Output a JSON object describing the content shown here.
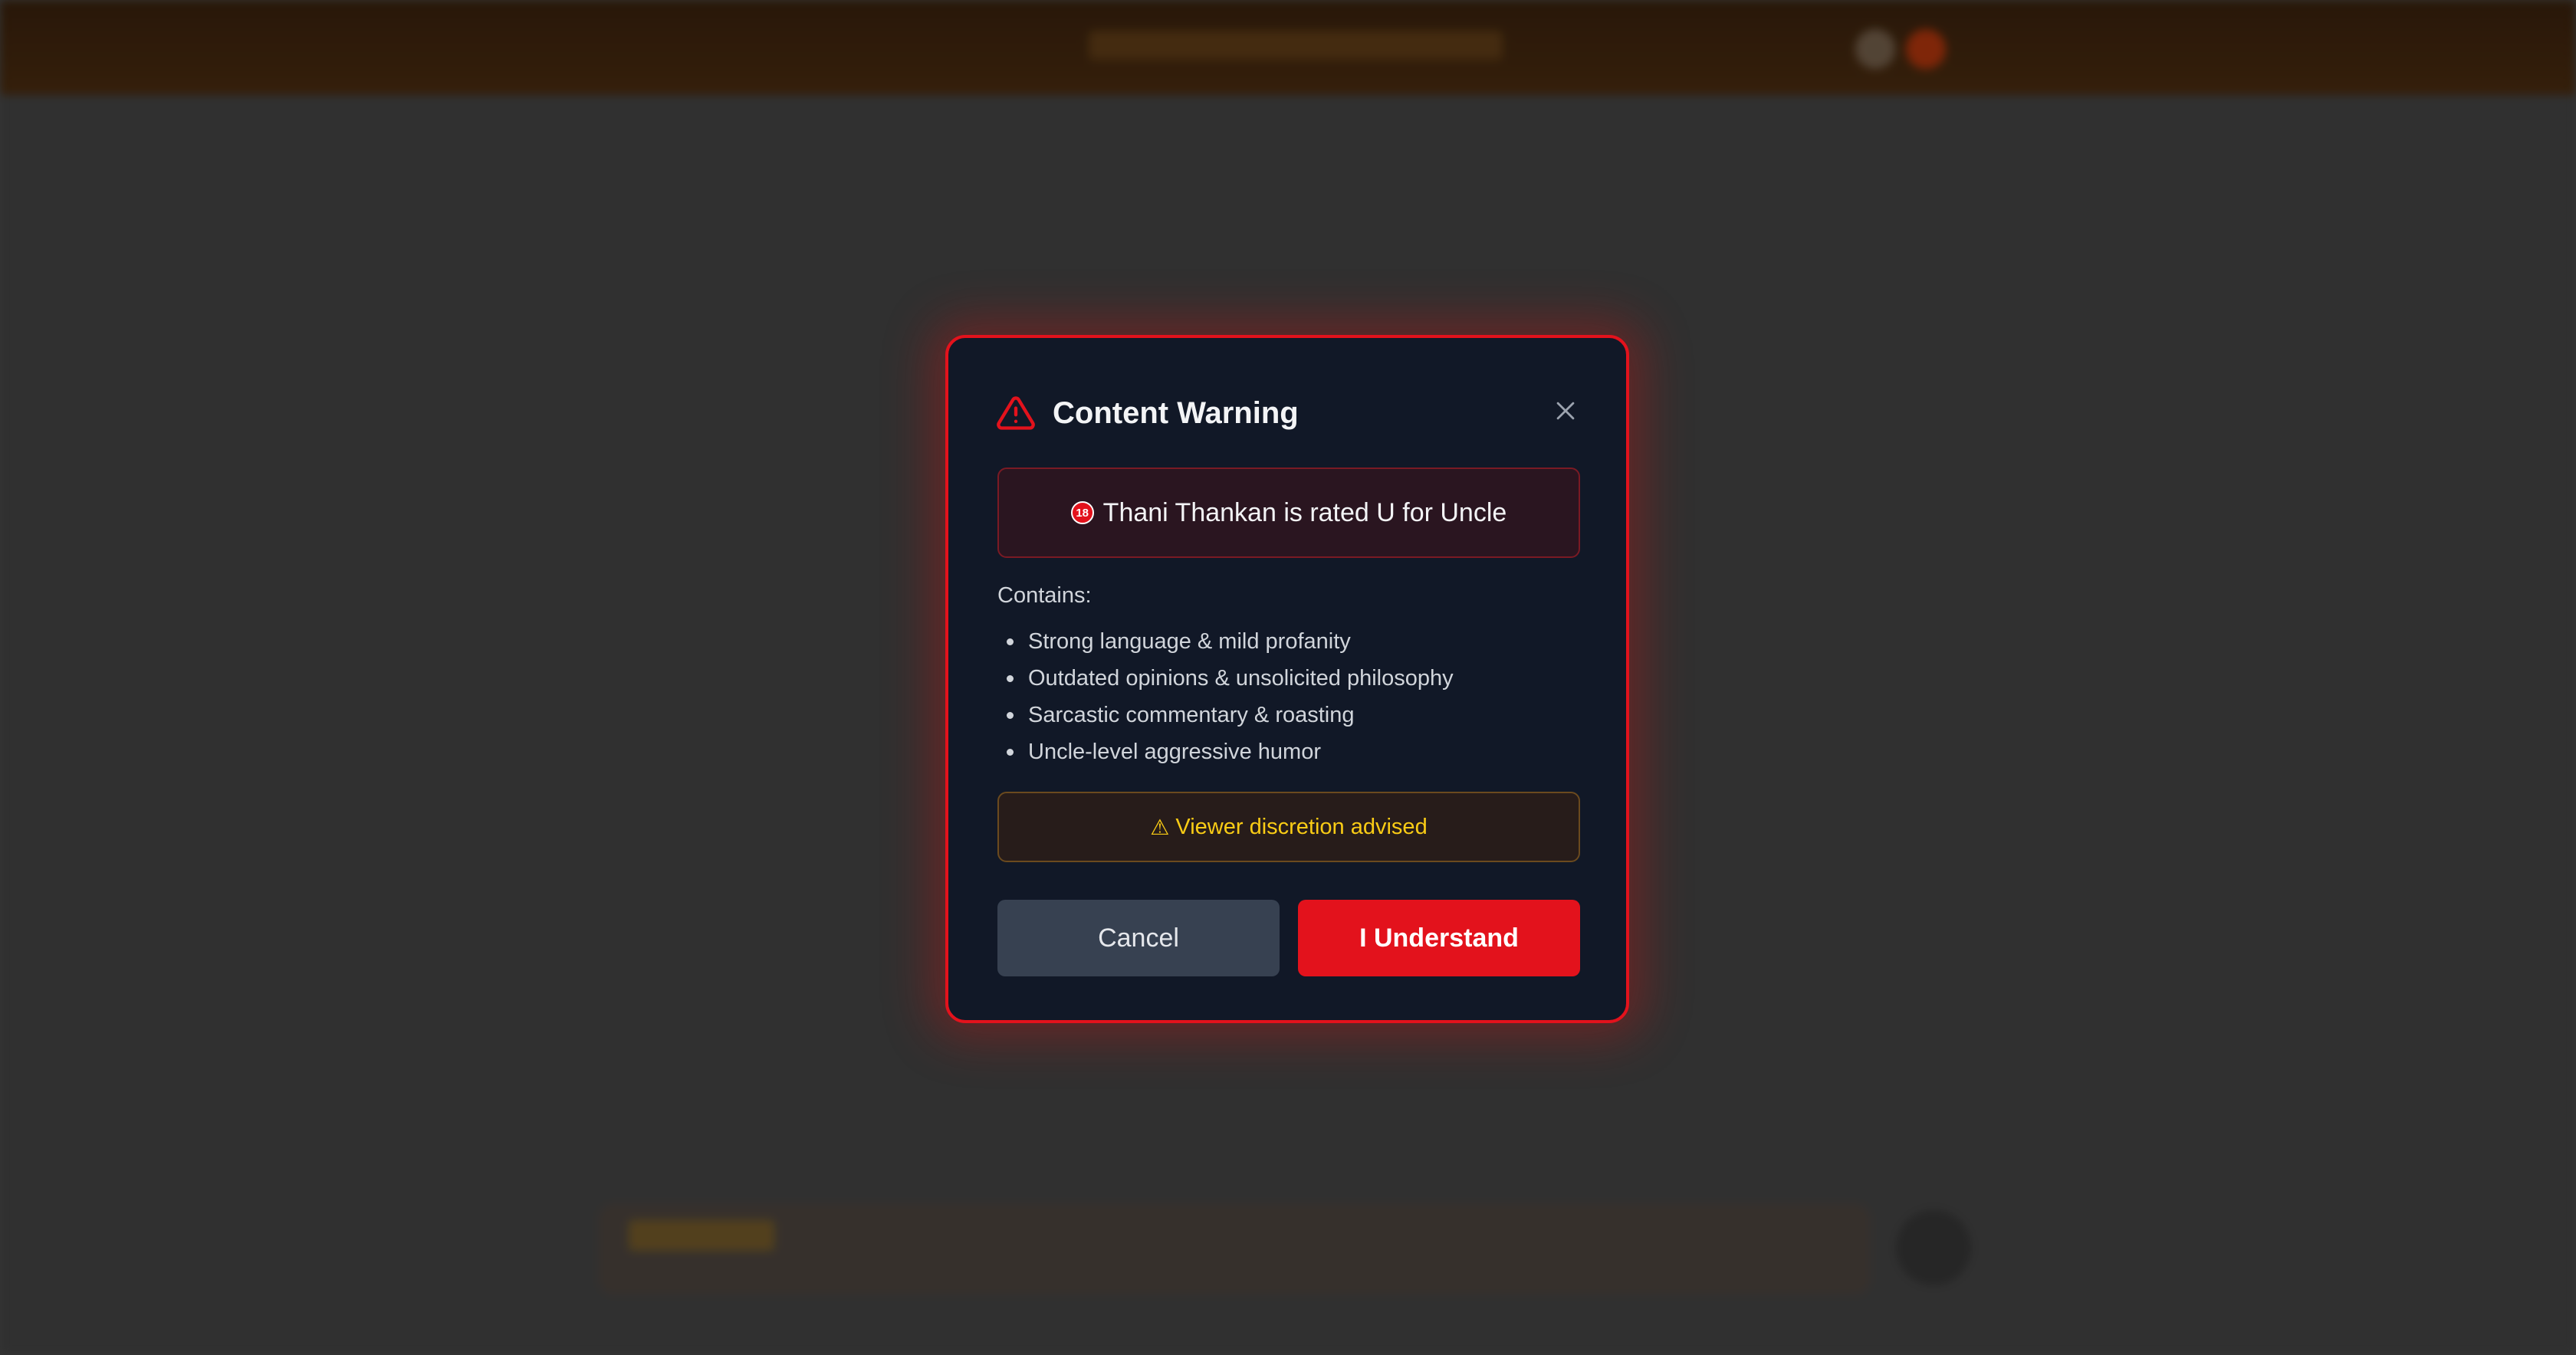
{
  "modal": {
    "title": "Content Warning",
    "rating_icon": "18",
    "rating_text": "Thani Thankan is rated U for Uncle",
    "contains_label": "Contains:",
    "contains_items": [
      "Strong language & mild profanity",
      "Outdated opinions & unsolicited philosophy",
      "Sarcastic commentary & roasting",
      "Uncle-level aggressive humor"
    ],
    "discretion_icon": "⚠",
    "discretion_text": "Viewer discretion advised",
    "cancel_label": "Cancel",
    "confirm_label": "I Understand"
  },
  "colors": {
    "accent": "#e3121c",
    "modal_bg": "#111827",
    "warning_text": "#facc15",
    "cancel_bg": "#374151"
  },
  "icons": {
    "warning": "warning-triangle-icon",
    "close": "close-icon",
    "rating": "no-under-18-icon"
  }
}
